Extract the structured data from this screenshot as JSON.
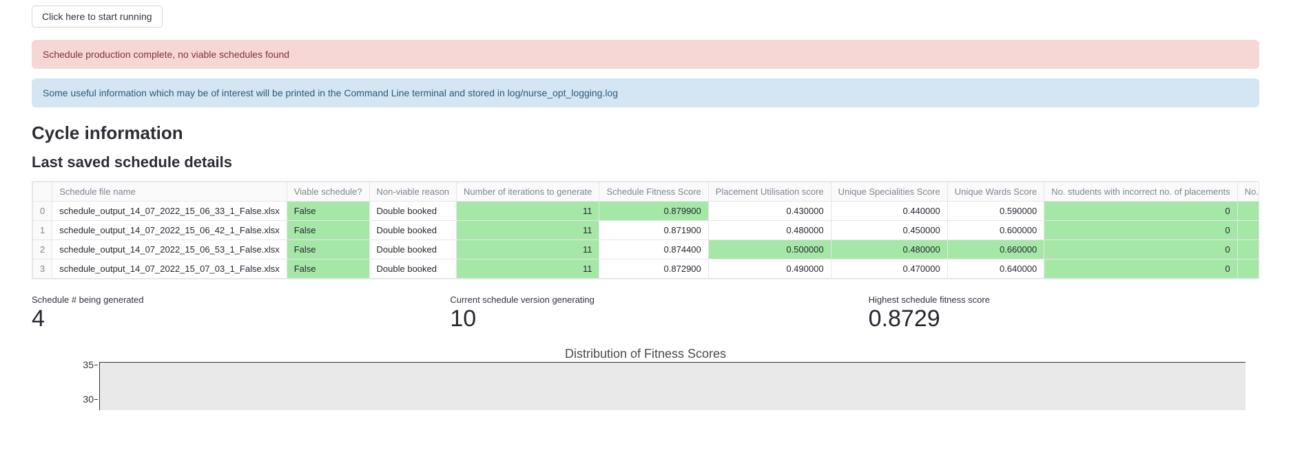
{
  "button_label": "Click here to start running",
  "alert_error": "Schedule production complete, no viable schedules found",
  "alert_info": "Some useful information which may be of interest will be printed in the Command Line terminal and stored in log/nurse_opt_logging.log",
  "cycle_heading": "Cycle information",
  "last_saved_heading": "Last saved schedule details",
  "table": {
    "columns": [
      "Schedule file name",
      "Viable schedule?",
      "Non-viable reason",
      "Number of iterations to generate",
      "Schedule Fitness Score",
      "Placement Utilisation score",
      "Unique Specialities Score",
      "Unique Wards Score",
      "No. students with incorrect no. of placements",
      "No. of placements with the incorrect leng"
    ],
    "rows": [
      {
        "idx": "0",
        "filename": "schedule_output_14_07_2022_15_06_33_1_False.xlsx",
        "viable": "False",
        "reason": "Double booked",
        "iterations": "11",
        "fitness": "0.879900",
        "placement_util": "0.430000",
        "unique_spec": "0.440000",
        "unique_wards": "0.590000",
        "incorrect_students": "0",
        "fitness_hl": true,
        "placement_util_hl": false,
        "unique_spec_hl": false,
        "unique_wards_hl": false
      },
      {
        "idx": "1",
        "filename": "schedule_output_14_07_2022_15_06_42_1_False.xlsx",
        "viable": "False",
        "reason": "Double booked",
        "iterations": "11",
        "fitness": "0.871900",
        "placement_util": "0.480000",
        "unique_spec": "0.450000",
        "unique_wards": "0.600000",
        "incorrect_students": "0",
        "fitness_hl": false,
        "placement_util_hl": false,
        "unique_spec_hl": false,
        "unique_wards_hl": false
      },
      {
        "idx": "2",
        "filename": "schedule_output_14_07_2022_15_06_53_1_False.xlsx",
        "viable": "False",
        "reason": "Double booked",
        "iterations": "11",
        "fitness": "0.874400",
        "placement_util": "0.500000",
        "unique_spec": "0.480000",
        "unique_wards": "0.660000",
        "incorrect_students": "0",
        "fitness_hl": false,
        "placement_util_hl": true,
        "unique_spec_hl": true,
        "unique_wards_hl": true
      },
      {
        "idx": "3",
        "filename": "schedule_output_14_07_2022_15_07_03_1_False.xlsx",
        "viable": "False",
        "reason": "Double booked",
        "iterations": "11",
        "fitness": "0.872900",
        "placement_util": "0.490000",
        "unique_spec": "0.470000",
        "unique_wards": "0.640000",
        "incorrect_students": "0",
        "fitness_hl": false,
        "placement_util_hl": false,
        "unique_spec_hl": false,
        "unique_wards_hl": false
      }
    ]
  },
  "metrics": {
    "schedule_num_label": "Schedule # being generated",
    "schedule_num_value": "4",
    "version_label": "Current schedule version generating",
    "version_value": "10",
    "highest_label": "Highest schedule fitness score",
    "highest_value": "0.8729"
  },
  "chart_data": {
    "type": "bar",
    "title": "Distribution of Fitness Scores",
    "y_ticks_visible": [
      "35",
      "30"
    ],
    "ylim": [
      0,
      37
    ],
    "xlabel": "",
    "ylabel": "",
    "note": "Only top portion of histogram visible; no bars rendered in visible area."
  }
}
